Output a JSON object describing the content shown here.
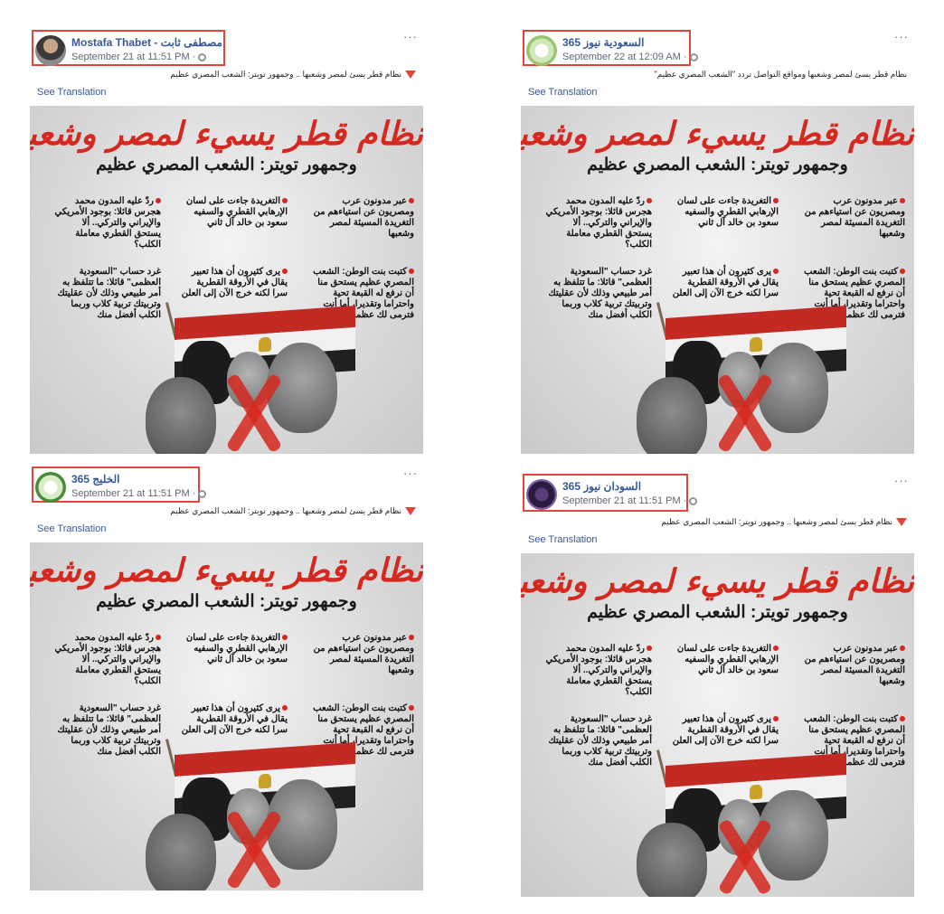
{
  "posts": [
    {
      "name": "Mostafa Thabet - مصطفى ثابت",
      "timestamp": "September 21 at 11:51 PM ·",
      "caption": "نظام قطر يسئ لمصر وشعبها .. وجمهور تويتر: الشعب المصري عظيم",
      "caption_marker": "red-triangle-icon",
      "see_translation": "See Translation",
      "more": "···",
      "avatar": "profile-photo-avatar"
    },
    {
      "name": "365 السعودية نيوز",
      "timestamp": "September 22 at 12:09 AM ·",
      "caption": "نظام قطر يسئ لمصر وشعبها ومواقع التواصل تردد \"الشعب المصري عظيم\"",
      "caption_marker": "",
      "see_translation": "See Translation",
      "more": "···",
      "avatar": "page-logo-avatar"
    },
    {
      "name": "365 الخليج",
      "timestamp": "September 21 at 11:51 PM ·",
      "caption": "نظام قطر يسئ لمصر وشعبها .. وجمهور تويتر: الشعب المصري عظيم",
      "caption_marker": "red-triangle-icon",
      "see_translation": "See Translation",
      "more": "···",
      "avatar": "page-logo-avatar"
    },
    {
      "name": "365 السودان نيوز",
      "timestamp": "September 21 at 11:51 PM ·",
      "caption": "نظام قطر يسئ لمصر وشعبها .. وجمهور تويتر: الشعب المصري عظيم",
      "caption_marker": "red-triangle-icon",
      "see_translation": "See Translation",
      "more": "···",
      "avatar": "page-logo-avatar"
    }
  ],
  "poster": {
    "headline": "نظام قطر يسيء لمصر وشعبها",
    "subhead": "وجمهور تويتر: الشعب المصري عظيم",
    "col_right_top": "عبر مدونون عرب ومصريون عن استياءهم من التغريدة المسيئة لمصر وشعبها",
    "col_mid_top": "التغريدة جاءت على لسان الإرهابي القطري والسفيه سعود بن خالد آل ثاني",
    "col_left_top": "ردّ عليه المدون محمد هجرس قائلا: بوجود الأمريكي والإيراني والتركي.. ألا يستحق القطري معاملة الكلب؟",
    "col_right_bottom": "كتبت بنت الوطن: الشعب المصري عظيم يستحق منا أن نرفع له القبعة تحية واحتراما وتقديرا، أما أنت فترمى لك عظمة لتنهشها",
    "col_mid_bottom": "يرى كثيرون أن هذا تعبير يقال في الأروقة القطرية سرا لكنه خرج الآن إلى العلن",
    "col_left_bottom": "غرد حساب \"السعودية العظمى\" قائلا: ما تتلفظ به أمر طبيعي وذلك لأن عقليتك وتربيتك تربية كلاب وربما الكلب أفضل منك"
  },
  "colors": {
    "highlight": "#e0463a",
    "link": "#385898",
    "headline": "#d6281f"
  }
}
